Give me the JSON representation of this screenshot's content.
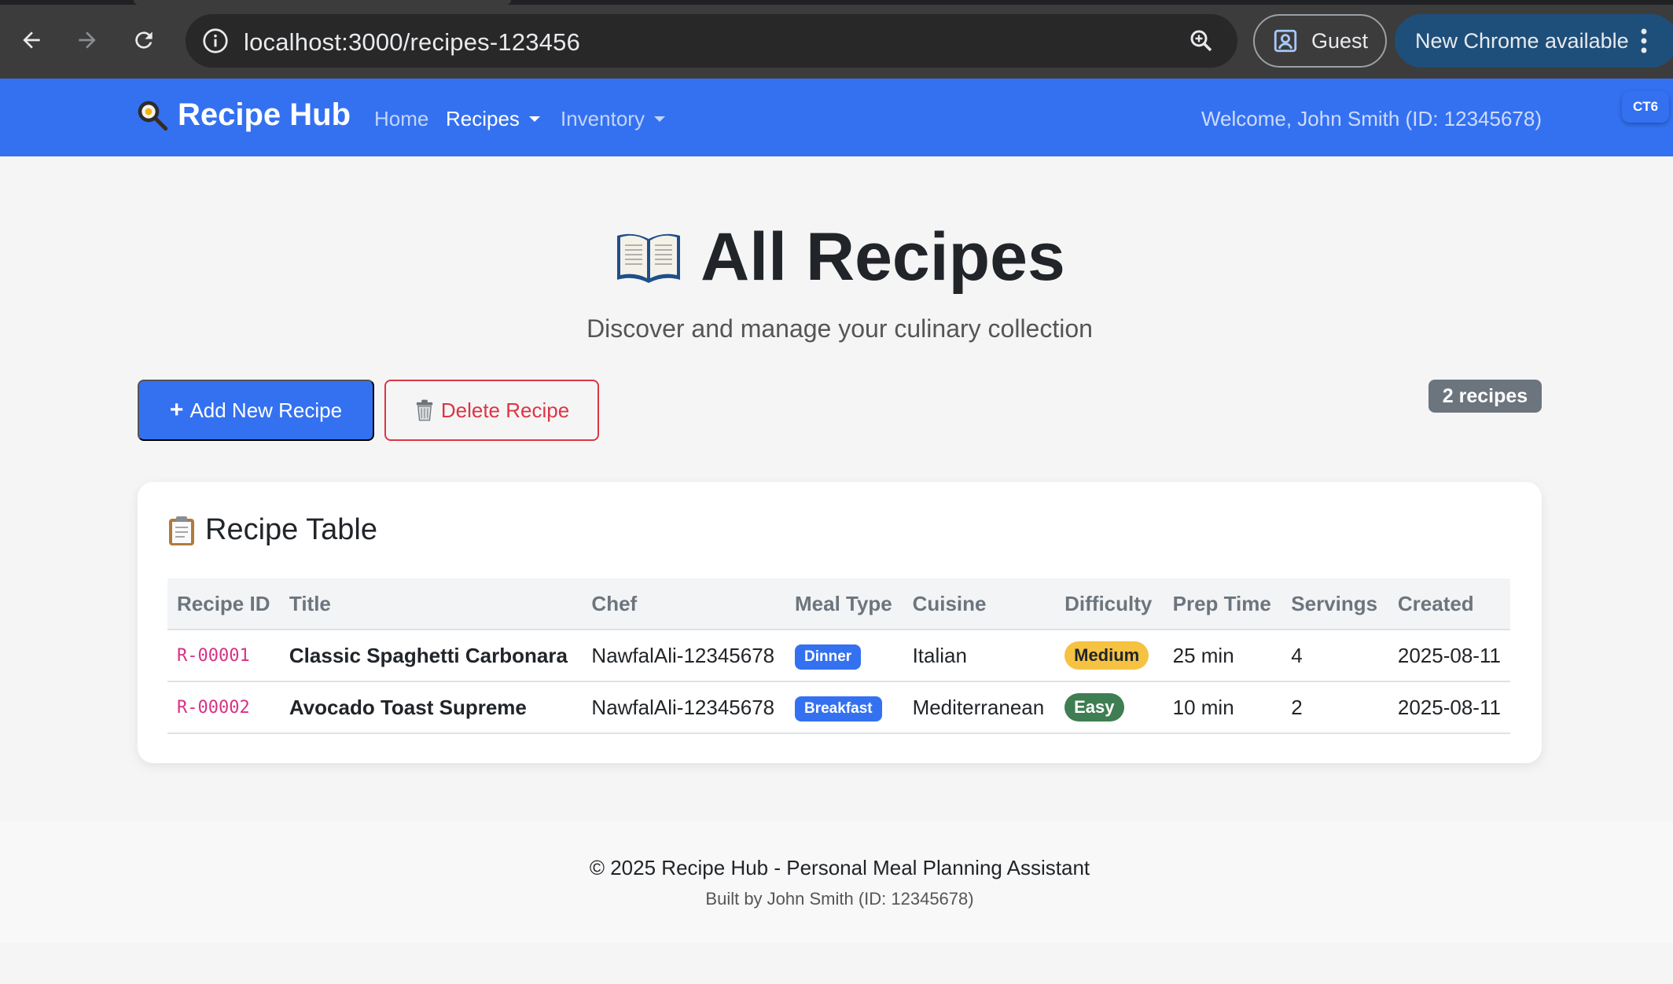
{
  "browser": {
    "url": "localhost:3000/recipes-123456",
    "guest_label": "Guest",
    "update_label": "New Chrome available"
  },
  "navbar": {
    "brand": "Recipe Hub",
    "links": [
      {
        "label": "Home"
      },
      {
        "label": "Recipes"
      },
      {
        "label": "Inventory"
      }
    ],
    "welcome": "Welcome, John Smith (ID: 12345678)",
    "corner_badge": "CT6",
    "colors": {
      "primary": "#3471f1"
    }
  },
  "hero": {
    "title": "All Recipes",
    "subtitle": "Discover and manage your culinary collection"
  },
  "actions": {
    "add_label": "Add New Recipe",
    "add_icon": "+",
    "delete_label": "Delete Recipe",
    "count_badge": "2 recipes"
  },
  "table": {
    "title": "Recipe Table",
    "columns": [
      "Recipe ID",
      "Title",
      "Chef",
      "Meal Type",
      "Cuisine",
      "Difficulty",
      "Prep Time",
      "Servings",
      "Created"
    ],
    "rows": [
      {
        "id": "R-00001",
        "title": "Classic Spaghetti Carbonara",
        "chef": "NawfalAli-12345678",
        "meal_type": "Dinner",
        "cuisine": "Italian",
        "difficulty": "Medium",
        "prep_time": "25 min",
        "servings": "4",
        "created": "2025-08-11"
      },
      {
        "id": "R-00002",
        "title": "Avocado Toast Supreme",
        "chef": "NawfalAli-12345678",
        "meal_type": "Breakfast",
        "cuisine": "Mediterranean",
        "difficulty": "Easy",
        "prep_time": "10 min",
        "servings": "2",
        "created": "2025-08-11"
      }
    ],
    "badge_colors": {
      "meal_type": "#3471f1",
      "medium": "#f5c242",
      "easy": "#3f7d52"
    }
  },
  "footer": {
    "line1": "© 2025 Recipe Hub - Personal Meal Planning Assistant",
    "line2": "Built by John Smith (ID: 12345678)"
  }
}
